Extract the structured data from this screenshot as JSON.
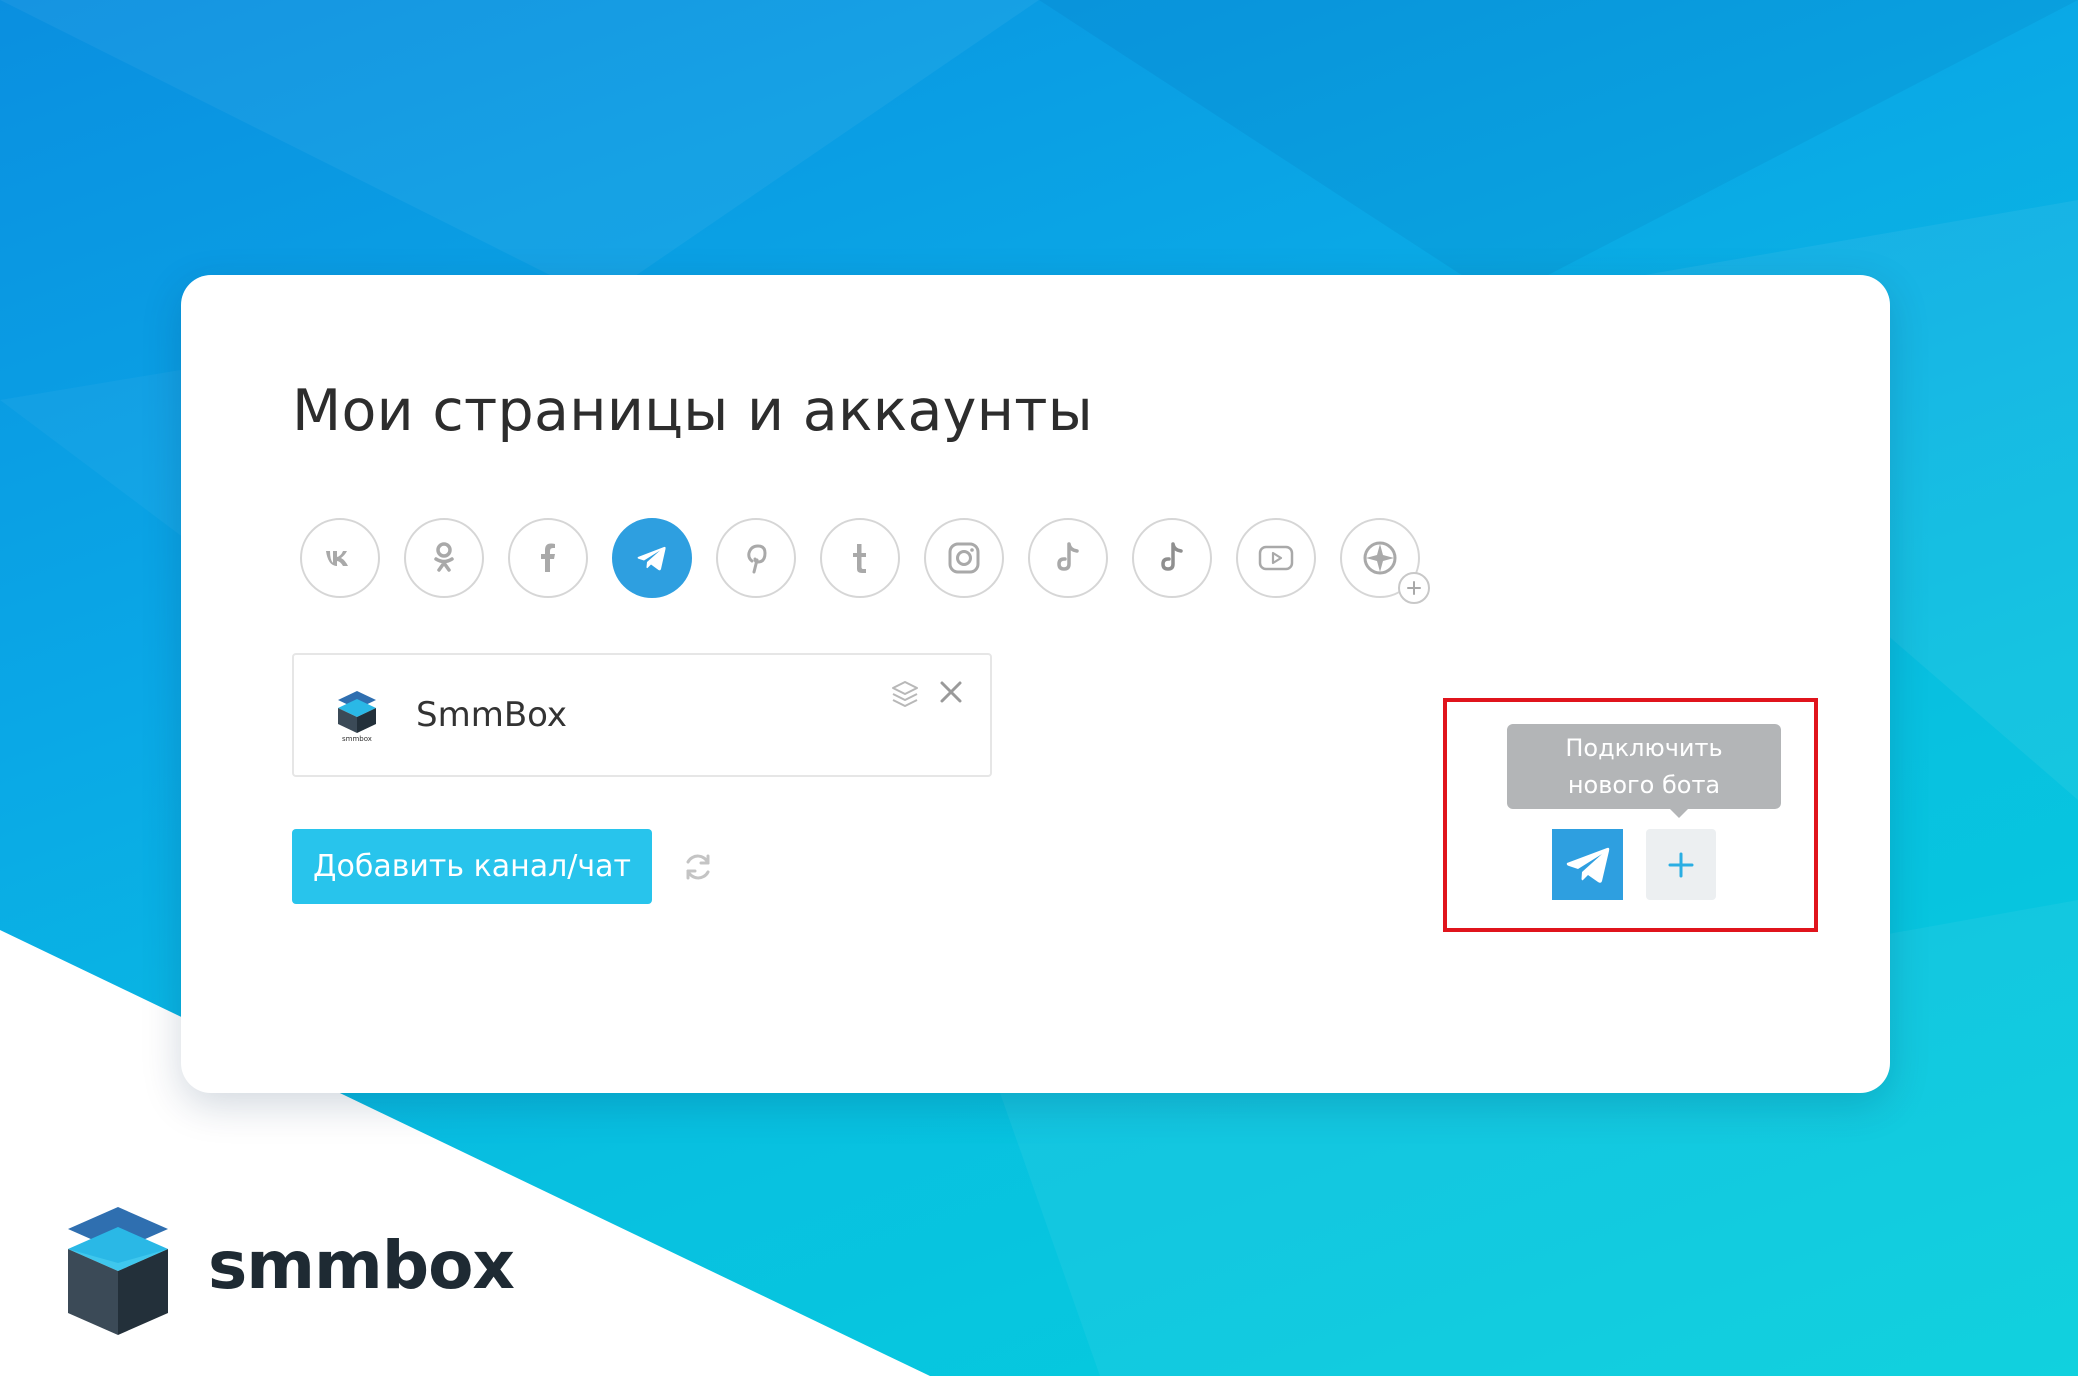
{
  "page": {
    "title": "Мои страницы и аккаунты"
  },
  "social_networks": [
    {
      "icon": "vk-icon",
      "active": false
    },
    {
      "icon": "odnoklassniki-icon",
      "active": false
    },
    {
      "icon": "facebook-icon",
      "active": false
    },
    {
      "icon": "telegram-icon",
      "active": true
    },
    {
      "icon": "pinterest-icon",
      "active": false
    },
    {
      "icon": "tumblr-icon",
      "active": false
    },
    {
      "icon": "instagram-icon",
      "active": false
    },
    {
      "icon": "tiktok-icon",
      "active": false
    },
    {
      "icon": "tiktok-icon",
      "active": false
    },
    {
      "icon": "youtube-icon",
      "active": false
    },
    {
      "icon": "add-network-icon",
      "active": false
    }
  ],
  "channel": {
    "name": "SmmBox",
    "logo_caption": "smmbox"
  },
  "actions": {
    "add_channel_label": "Добавить канал/чат"
  },
  "bot_panel": {
    "tooltip_line1": "Подключить",
    "tooltip_line2": "нового бота"
  },
  "brand": {
    "name": "smmbox"
  },
  "colors": {
    "accent": "#2e9fe0",
    "button": "#28c4ec",
    "highlight_border": "#e0141c",
    "tooltip_bg": "#b3b5b7"
  }
}
